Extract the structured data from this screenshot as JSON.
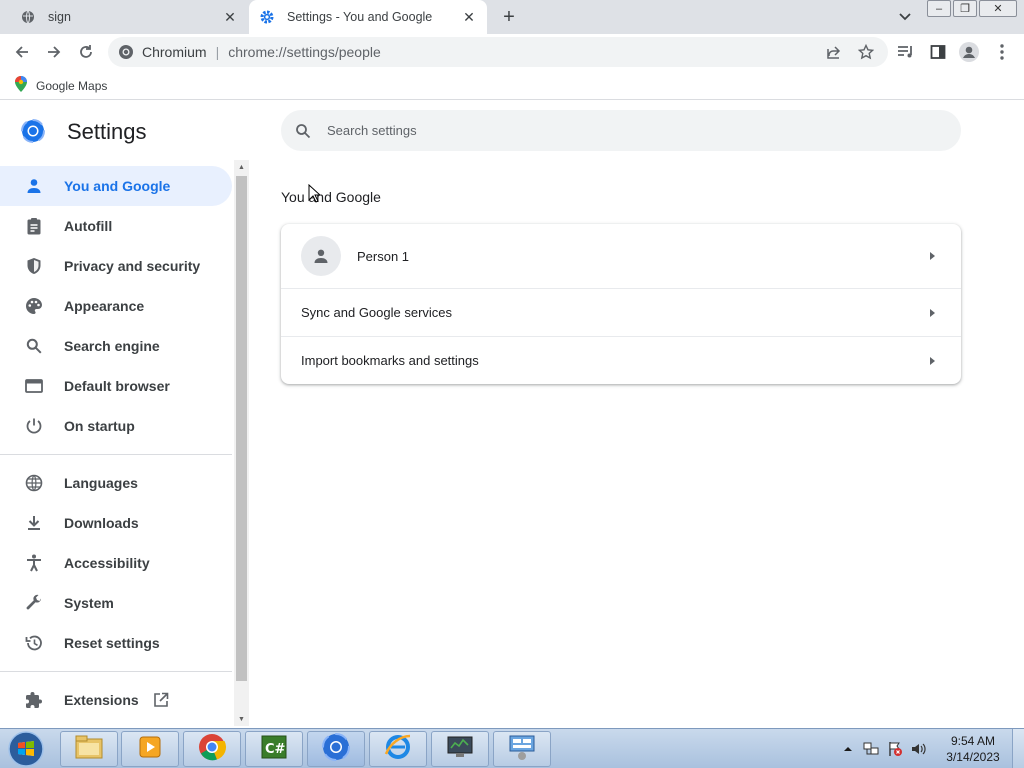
{
  "tabs": [
    {
      "title": "sign",
      "close": "✕"
    },
    {
      "title": "Settings - You and Google",
      "close": "✕"
    }
  ],
  "new_tab": "+",
  "window_buttons": {
    "minimize": "–",
    "restore": "❐",
    "close": "✕"
  },
  "omnibox": {
    "site": "Chromium",
    "separator": "|",
    "url": "chrome://settings/people"
  },
  "bookmarks": [
    {
      "label": "Google Maps"
    }
  ],
  "settings": {
    "title": "Settings",
    "search_placeholder": "Search settings",
    "nav_primary": [
      {
        "label": "You and Google",
        "icon": "person-icon",
        "active": true
      },
      {
        "label": "Autofill",
        "icon": "clipboard-icon"
      },
      {
        "label": "Privacy and security",
        "icon": "shield-icon"
      },
      {
        "label": "Appearance",
        "icon": "palette-icon"
      },
      {
        "label": "Search engine",
        "icon": "search-icon"
      },
      {
        "label": "Default browser",
        "icon": "browser-icon"
      },
      {
        "label": "On startup",
        "icon": "power-icon"
      }
    ],
    "nav_secondary": [
      {
        "label": "Languages",
        "icon": "globe-icon"
      },
      {
        "label": "Downloads",
        "icon": "download-icon"
      },
      {
        "label": "Accessibility",
        "icon": "accessibility-icon"
      },
      {
        "label": "System",
        "icon": "wrench-icon"
      },
      {
        "label": "Reset settings",
        "icon": "history-icon"
      }
    ],
    "nav_extensions": {
      "label": "Extensions",
      "icon": "puzzle-icon"
    },
    "section_title": "You and Google",
    "card_rows": [
      {
        "label": "Person 1"
      },
      {
        "label": "Sync and Google services"
      },
      {
        "label": "Import bookmarks and settings"
      }
    ]
  },
  "taskbar": {
    "apps": [
      "explorer-icon",
      "media-player-icon",
      "chrome-icon",
      "csharp-icon",
      "chromium-icon",
      "ie-icon",
      "monitor-icon",
      "control-panel-icon"
    ],
    "time": "9:54 AM",
    "date": "3/14/2023"
  },
  "colors": {
    "accent": "#1a73e8",
    "active_bg": "#e8f0fe",
    "tabstrip": "#dee1e6"
  }
}
